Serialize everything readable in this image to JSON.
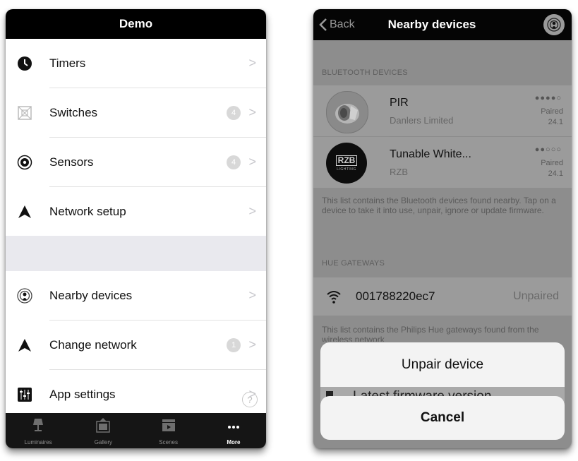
{
  "left": {
    "title": "Demo",
    "items": [
      {
        "label": "Timers",
        "icon": "clock-icon",
        "badge": ""
      },
      {
        "label": "Switches",
        "icon": "switch-icon",
        "badge": "4"
      },
      {
        "label": "Sensors",
        "icon": "sensor-icon",
        "badge": "4"
      },
      {
        "label": "Network setup",
        "icon": "network-icon",
        "badge": ""
      },
      {
        "label": "Nearby devices",
        "icon": "nearby-devices-icon",
        "badge": ""
      },
      {
        "label": "Change network",
        "icon": "network-icon",
        "badge": "1"
      },
      {
        "label": "App settings",
        "icon": "settings-sliders-icon",
        "badge": ""
      }
    ],
    "chevron": ">",
    "help": "?",
    "tabs": [
      {
        "label": "Luminaires",
        "icon": "lamp-icon"
      },
      {
        "label": "Gallery",
        "icon": "gallery-icon"
      },
      {
        "label": "Scenes",
        "icon": "scenes-icon"
      },
      {
        "label": "More",
        "icon": "more-icon"
      }
    ]
  },
  "right": {
    "back_label": "Back",
    "title": "Nearby devices",
    "bt_header": "BLUETOOTH DEVICES",
    "devices": [
      {
        "name": "PIR",
        "maker": "Danlers Limited",
        "signal": "●●●●○",
        "status": "Paired",
        "version": "24.1"
      },
      {
        "name": "Tunable White...",
        "maker": "RZB",
        "signal": "●●○○○",
        "status": "Paired",
        "version": "24.1"
      }
    ],
    "rzb_logo": "RZB",
    "rzb_logo_sub": "LIGHTING",
    "bt_note": "This list contains the Bluetooth devices found nearby. Tap on a device to take it into use, unpair, ignore or update firmware.",
    "hue_header": "HUE GATEWAYS",
    "hue": {
      "id": "001788220ec7",
      "status": "Unpaired"
    },
    "hue_note": "This list contains the Philips Hue gateways found from the wireless network",
    "sheet_underlay": "Latest firmware version",
    "sheet_action": "Unpair device",
    "sheet_cancel": "Cancel"
  }
}
